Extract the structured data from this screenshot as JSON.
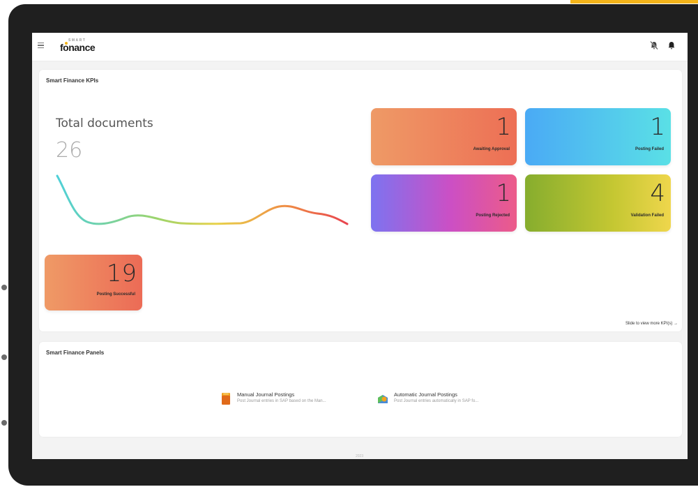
{
  "app": {
    "logo_prefix": "SMART",
    "logo_name": "fonance"
  },
  "header": {
    "menu_icon": "hamburger-menu-icon",
    "notifications_off_icon": "bell-off-icon",
    "notifications_icon": "bell-icon"
  },
  "kpis": {
    "title": "Smart Finance KPIs",
    "total_label": "Total documents",
    "total_value": "26",
    "tiles": [
      {
        "value": "1",
        "label": "Awaiting Approval",
        "color": "#ed7f5c"
      },
      {
        "value": "1",
        "label": "Posting Failed",
        "color": "#4fc4ee"
      },
      {
        "value": "1",
        "label": "Posting Rejected",
        "color": "#c64fc8"
      },
      {
        "value": "4",
        "label": "Validation Failed",
        "color": "#a9bd2f"
      },
      {
        "value": "19",
        "label": "Posting Successful",
        "color": "#ed7f5c"
      }
    ],
    "slide_link": "Slide to view more KPI(s) →"
  },
  "panels": {
    "title": "Smart Finance Panels",
    "items": [
      {
        "title": "Manual Journal Postings",
        "description": "Post Journal entries in SAP based on the Man...",
        "icon": "document-folder-icon"
      },
      {
        "title": "Automatic Journal Postings",
        "description": "Post Journal entries automatically in SAP fo...",
        "icon": "auto-posting-icon"
      }
    ]
  },
  "footer": {
    "text": "2023"
  },
  "colors": {
    "accent": "#f4b41a",
    "frame": "#1f1f1f",
    "background": "#f3f3f3"
  }
}
